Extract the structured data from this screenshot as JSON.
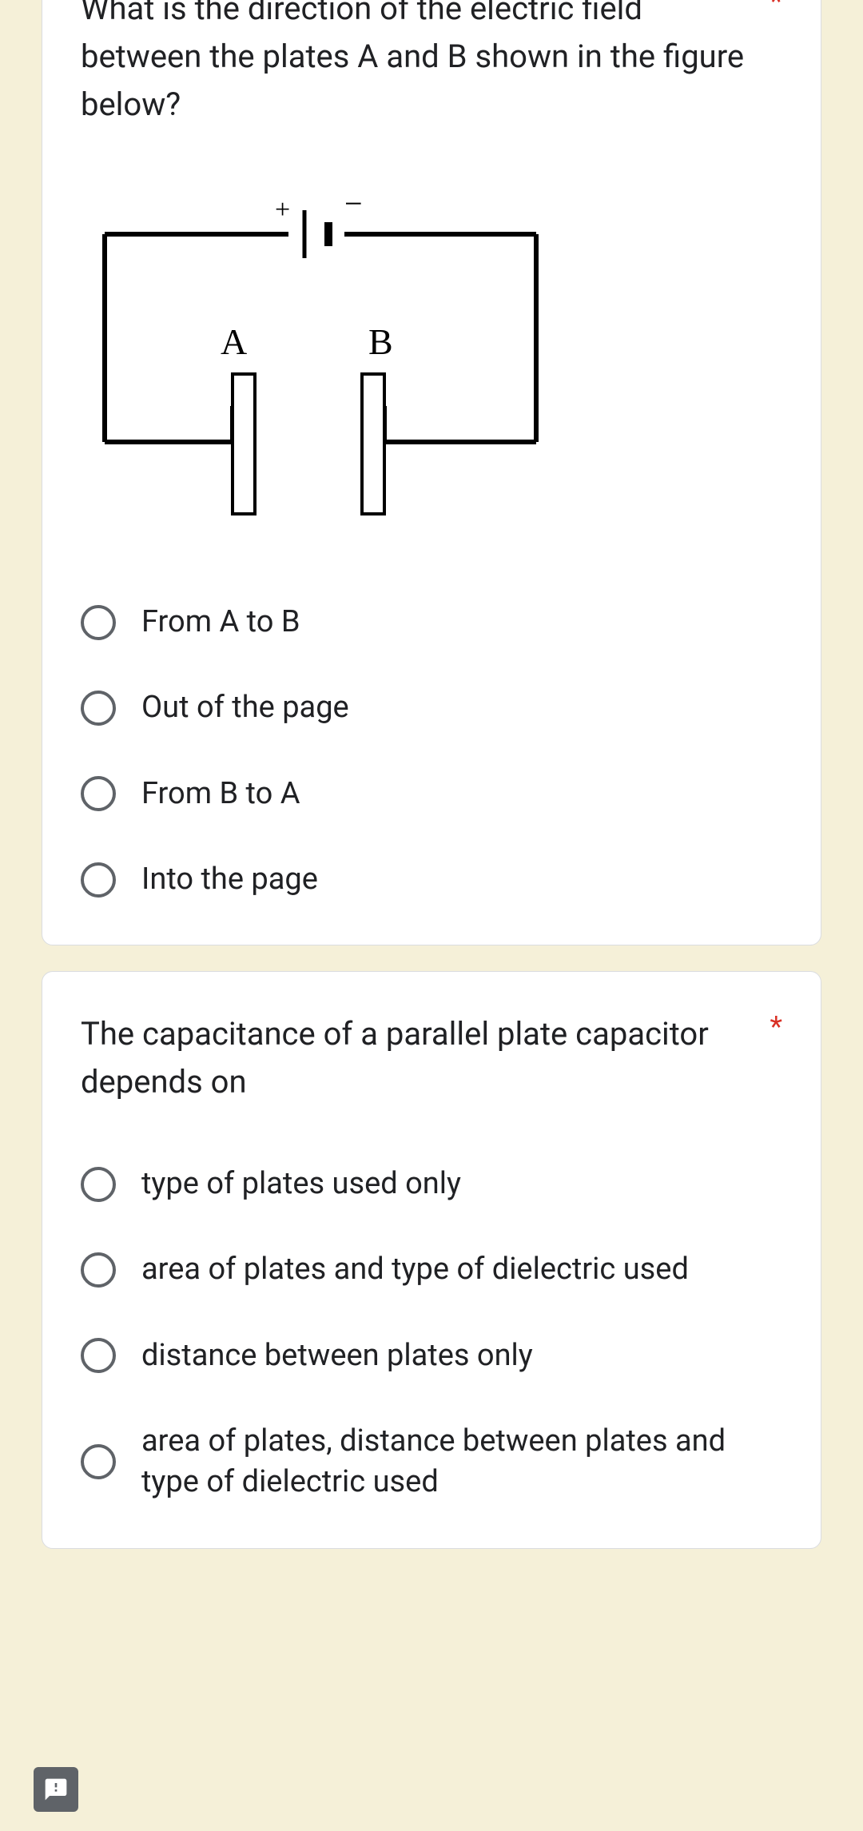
{
  "questions": [
    {
      "text": "What is the direction of the electric field between the plates A and B shown in the figure below?",
      "required": "*",
      "figure": {
        "plus": "+",
        "minus": "−",
        "labelA": "A",
        "labelB": "B"
      },
      "options": [
        "From A to B",
        "Out of the page",
        "From B to A",
        "Into the page"
      ]
    },
    {
      "text": "The capacitance of a parallel plate capacitor depends on",
      "required": "*",
      "options": [
        "type of plates used only",
        "area of plates and type of dielectric used",
        "distance between plates only",
        "area of plates, distance between plates and type of dielectric used"
      ]
    }
  ]
}
